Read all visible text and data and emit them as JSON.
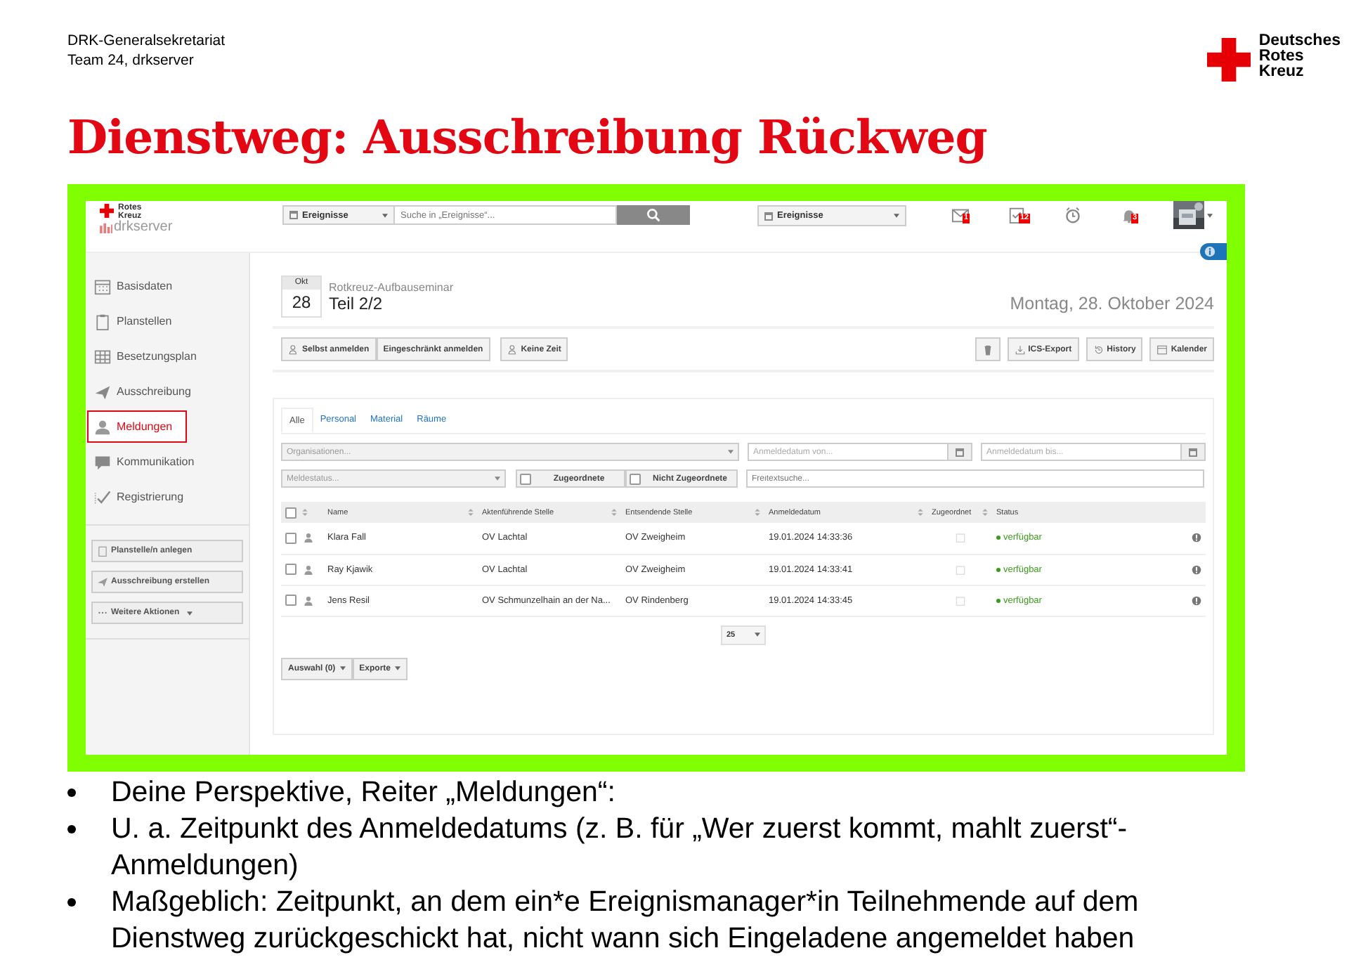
{
  "header": {
    "org": "DRK-Generalsekretariat",
    "team": "Team 24, drkserver"
  },
  "brand_logo": {
    "lines": [
      "Deutsches",
      "Rotes",
      "Kreuz"
    ]
  },
  "title": "Dienstweg: Ausschreibung Rückweg",
  "app": {
    "logo": {
      "lines": [
        "Rotes",
        "Kreuz"
      ],
      "product": "drkserver"
    },
    "search": {
      "scope": "Ereignisse",
      "placeholder": "Suche in „Ereignisse“..."
    },
    "context_select": "Ereignisse",
    "notifications": [
      {
        "kind": "mail",
        "badge": "1"
      },
      {
        "kind": "tasks",
        "badge": "12"
      },
      {
        "kind": "alarm"
      },
      {
        "kind": "bell",
        "badge": "3"
      }
    ],
    "sidebar": {
      "items": [
        {
          "kind": "calendar",
          "label": "Basisdaten",
          "selected": false
        },
        {
          "kind": "clipboard",
          "label": "Planstellen",
          "selected": false
        },
        {
          "kind": "grid",
          "label": "Besetzungsplan",
          "selected": false
        },
        {
          "kind": "plane",
          "label": "Ausschreibung",
          "selected": false
        },
        {
          "kind": "person",
          "label": "Meldungen",
          "selected": true
        },
        {
          "kind": "chat",
          "label": "Kommunikation",
          "selected": false
        },
        {
          "kind": "check",
          "label": "Registrierung",
          "selected": false
        }
      ],
      "actions": [
        {
          "kind": "clipboard",
          "label": "Planstelle/n anlegen"
        },
        {
          "kind": "plane",
          "label": "Ausschreibung erstellen"
        },
        {
          "kind": "more",
          "label": "Weitere Aktionen"
        }
      ]
    },
    "event": {
      "month": "Okt",
      "day": "28",
      "category": "Rotkreuz-Aufbauseminar",
      "name": "Teil 2/2",
      "date": "Montag, 28. Oktober 2024"
    },
    "actions_left": [
      {
        "kind": "person",
        "label": "Selbst anmelden"
      },
      {
        "kind": "none",
        "label": "Eingeschränkt  anmelden"
      },
      {
        "kind": "person",
        "label": "Keine Zeit"
      }
    ],
    "actions_right": [
      {
        "kind": "trash"
      },
      {
        "kind": "export",
        "label": "ICS-Export"
      },
      {
        "kind": "history",
        "label": "History"
      },
      {
        "kind": "calendar",
        "label": "Kalender"
      }
    ],
    "tabs": [
      {
        "label": "Alle",
        "selected": true
      },
      {
        "label": "Personal",
        "selected": false
      },
      {
        "label": "Material",
        "selected": false
      },
      {
        "label": "Räume",
        "selected": false
      }
    ],
    "filters": {
      "organisations": {
        "placeholder": "Organisationen..."
      },
      "date_from": {
        "placeholder": "Anmeldedatum von..."
      },
      "date_to": {
        "placeholder": "Anmeldedatum bis..."
      },
      "status": {
        "placeholder": "Meldestatus..."
      },
      "toggles": [
        {
          "label": "Zugeordnete",
          "checked": false
        },
        {
          "label": "Nicht Zugeordnete",
          "checked": false
        }
      ],
      "text_search": {
        "placeholder": "Freitextsuche..."
      }
    },
    "table": {
      "select_all": false,
      "columns": [
        "Name",
        "Aktenführende Stelle",
        "Entsendende Stelle",
        "Anmeldedatum",
        "Zugeordnet",
        "Status"
      ],
      "rows": [
        {
          "checked": false,
          "name": "Klara Fall",
          "lead_unit": "OV Lachtal",
          "sending_unit": "OV Zweigheim",
          "date": "19.01.2024 14:33:36",
          "status": "verfügbar",
          "color": "#3c9a1e"
        },
        {
          "checked": false,
          "name": "Ray Kjawik",
          "lead_unit": "OV Lachtal",
          "sending_unit": "OV Zweigheim",
          "date": "19.01.2024 14:33:41",
          "status": "verfügbar",
          "color": "#3c9a1e"
        },
        {
          "checked": false,
          "name": "Jens Resil",
          "lead_unit": "OV Schmunzelhain an der Na...",
          "sending_unit": "OV Rindenberg",
          "date": "19.01.2024 14:33:45",
          "status": "verfügbar",
          "color": "#3c9a1e"
        }
      ]
    },
    "page_size": "25",
    "footer_buttons": [
      "Auswahl (0)",
      "Exporte"
    ]
  },
  "bullets": [
    "Deine Perspektive, Reiter „Meldungen“:",
    "U. a. Zeitpunkt des Anmeldedatums (z. B. für „Wer zuerst kommt, mahlt zuerst“-Anmeldungen)",
    "Maßgeblich: Zeitpunkt, an dem ein*e Ereignismanager*in Teilnehmende auf dem Dienstweg zurückgeschickt hat, nicht wann sich Eingeladene angemeldet haben"
  ]
}
